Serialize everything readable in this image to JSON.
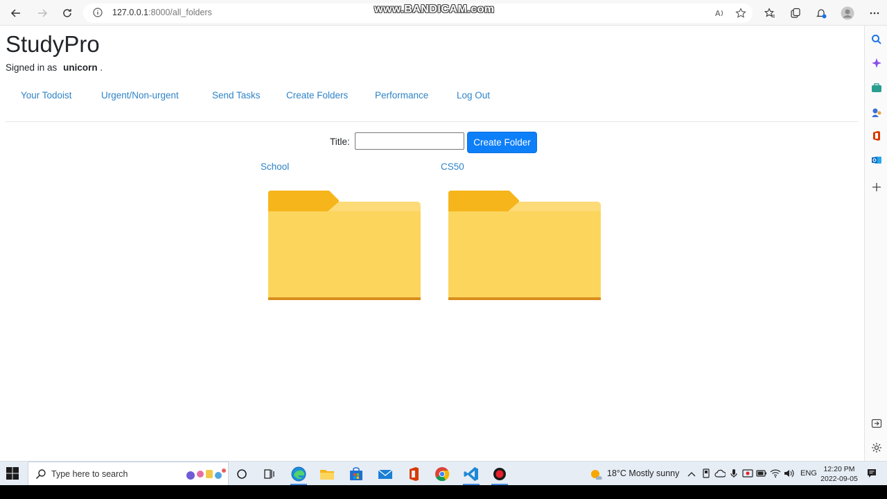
{
  "browser": {
    "url_host": "127.0.0.1",
    "url_rest": ":8000/all_folders",
    "watermark": "www.BANDICAM.com"
  },
  "site": {
    "brand": "StudyPro",
    "signed_in_prefix": "Signed in as",
    "username": "unicorn",
    "username_suffix": ".",
    "nav": [
      {
        "label": "Your Todoist"
      },
      {
        "label": "Urgent/Non-urgent"
      },
      {
        "label": "Send Tasks"
      },
      {
        "label": "Create Folders"
      },
      {
        "label": "Performance"
      },
      {
        "label": "Log Out"
      }
    ]
  },
  "form": {
    "title_label": "Title:",
    "title_value": "",
    "button_label": "Create Folder"
  },
  "folders": [
    {
      "name": "School"
    },
    {
      "name": "CS50"
    }
  ],
  "taskbar": {
    "search_placeholder": "Type here to search",
    "weather": "18°C  Mostly sunny",
    "language": "ENG",
    "time": "12:20 PM",
    "date": "2022-09-05"
  },
  "colors": {
    "link": "#2f83c7",
    "button": "#0d7ff9",
    "folder_front": "#fcd55c",
    "folder_tab": "#f6b51a"
  }
}
